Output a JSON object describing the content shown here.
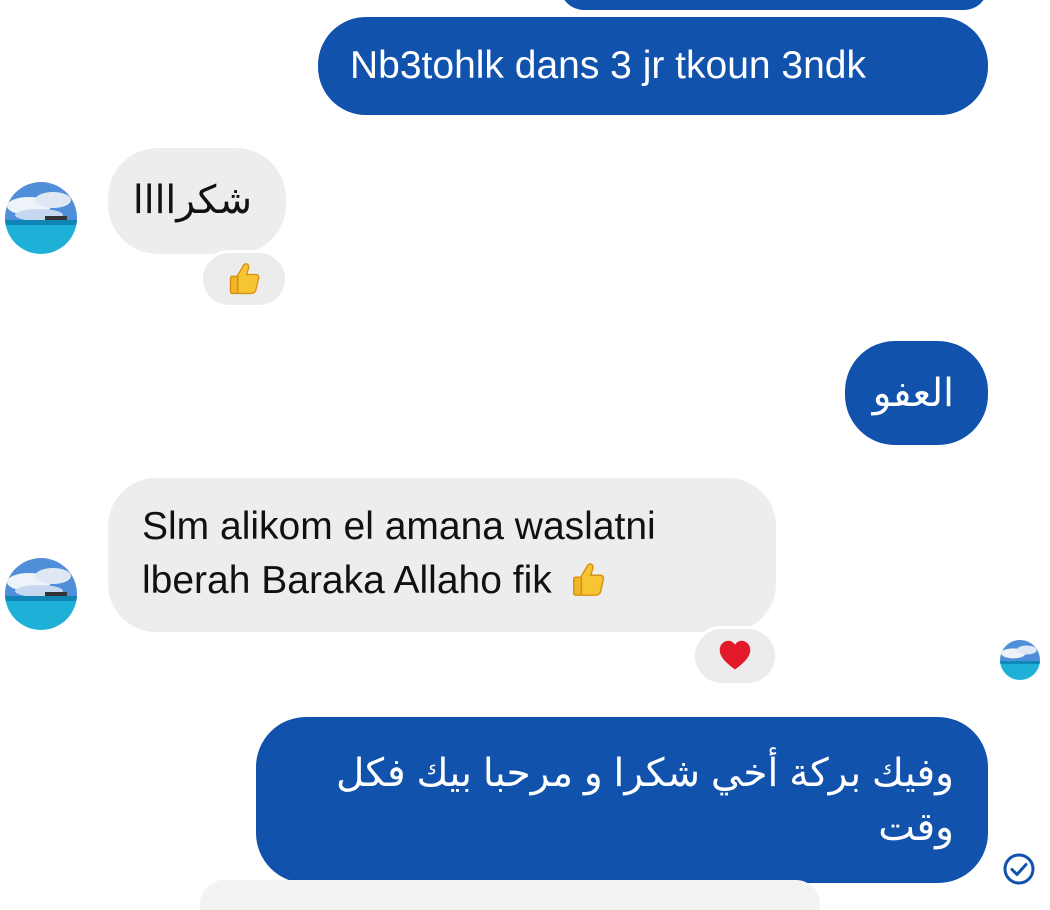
{
  "conversation": {
    "messages": [
      {
        "id": "m1",
        "direction": "outgoing",
        "text": "Nb3tohlk dans 3 jr tkoun 3ndk"
      },
      {
        "id": "m2",
        "direction": "incoming",
        "text": "شكراااا",
        "reaction": "thumbs-up-icon"
      },
      {
        "id": "m3",
        "direction": "outgoing",
        "text": "العفو"
      },
      {
        "id": "m4",
        "direction": "incoming",
        "lines": [
          "Slm alikom el amana waslatni",
          "lberah Baraka Allaho fik"
        ],
        "emoji": "thumbs-up-icon",
        "reaction": "heart-icon"
      },
      {
        "id": "m5",
        "direction": "outgoing",
        "lines": [
          "وفيك بركة أخي شكرا و مرحبا بيك فكل",
          "وقت"
        ],
        "status": "sent-check-icon"
      }
    ]
  },
  "colors": {
    "outgoing_bubble": "#1152ad",
    "incoming_bubble": "#ededee",
    "reaction_background": "#ececec",
    "status_icon": "#1152ad"
  }
}
